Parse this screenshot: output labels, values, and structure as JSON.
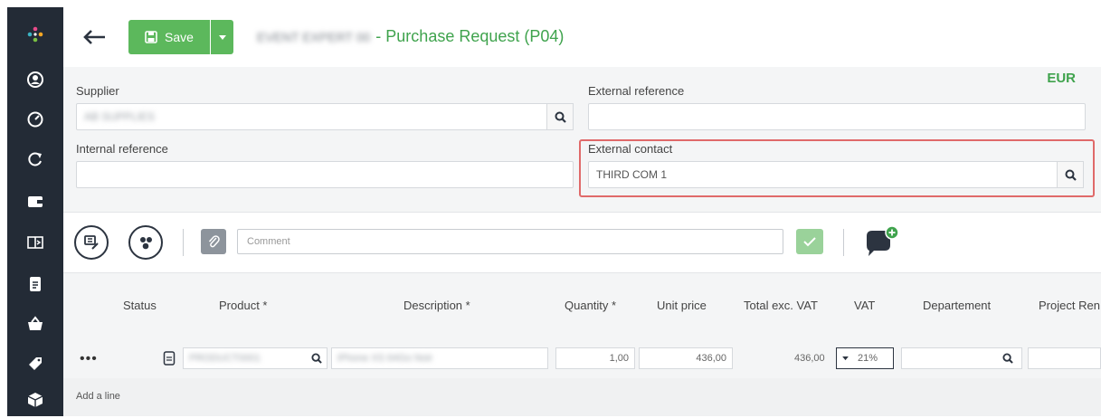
{
  "app": {
    "save_label": "Save",
    "title_blurred": "EVENT EXPERT 00",
    "title_suffix": "- Purchase Request (P04)",
    "currency": "EUR",
    "accent_color": "#5cb85c",
    "highlight_color": "#e06a6a"
  },
  "sidebar": {
    "items": [
      {
        "icon": "logo-dots-icon"
      },
      {
        "icon": "user-icon"
      },
      {
        "icon": "dashboard-gauge-icon"
      },
      {
        "icon": "refresh-icon"
      },
      {
        "icon": "wallet-icon"
      },
      {
        "icon": "book-icon"
      },
      {
        "icon": "document-icon"
      },
      {
        "icon": "basket-icon"
      },
      {
        "icon": "tag-icon"
      },
      {
        "icon": "box-icon"
      }
    ]
  },
  "form": {
    "supplier_label": "Supplier",
    "supplier_value": "AB SUPPLIES",
    "external_reference_label": "External reference",
    "external_reference_value": "",
    "internal_reference_label": "Internal reference",
    "internal_reference_value": "",
    "external_contact_label": "External contact",
    "external_contact_value": "THIRD COM 1"
  },
  "toolbar": {
    "comment_placeholder": "Comment"
  },
  "table": {
    "columns": [
      "Status",
      "Product *",
      "Description *",
      "Quantity *",
      "Unit price",
      "Total exc. VAT",
      "VAT",
      "Departement",
      "Project Ren"
    ],
    "row": {
      "menu": "•••",
      "product": "PRODUCT0001",
      "description": "iPhone XS 64Go Noir",
      "quantity": "1,00",
      "unit_price": "436,00",
      "total": "436,00",
      "vat": "21%"
    },
    "add_line": "Add a line"
  }
}
